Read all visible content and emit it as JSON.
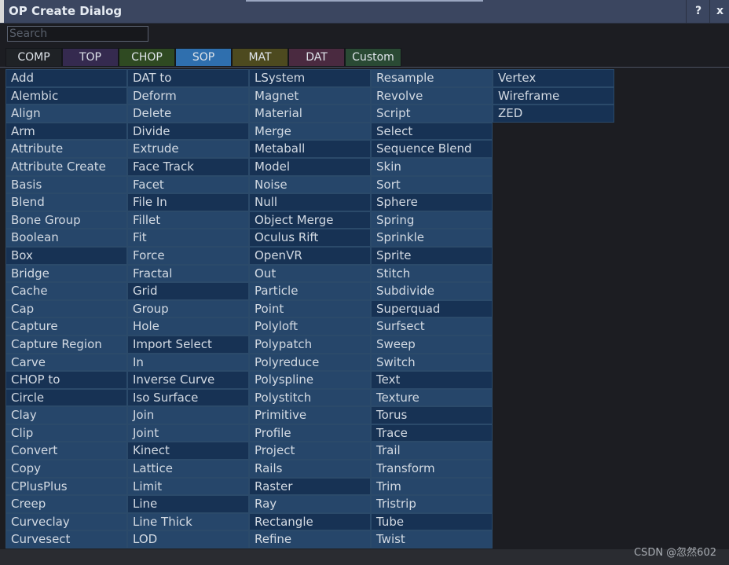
{
  "window": {
    "title": "OP Create Dialog",
    "help_label": "?",
    "close_label": "x"
  },
  "search": {
    "placeholder": "Search",
    "value": ""
  },
  "tabs": [
    {
      "label": "COMP",
      "color": "#1f2226"
    },
    {
      "label": "TOP",
      "color": "#352a4f"
    },
    {
      "label": "CHOP",
      "color": "#2f4a22"
    },
    {
      "label": "SOP",
      "color": "#2f6fae"
    },
    {
      "label": "MAT",
      "color": "#4d4a1f"
    },
    {
      "label": "DAT",
      "color": "#4a2a40"
    },
    {
      "label": "Custom",
      "color": "#2a4a34"
    }
  ],
  "active_tab": "SOP",
  "operators": [
    "Add",
    "Alembic",
    "Align",
    "Arm",
    "Attribute",
    "Attribute Create",
    "Basis",
    "Blend",
    "Bone Group",
    "Boolean",
    "Box",
    "Bridge",
    "Cache",
    "Cap",
    "Capture",
    "Capture Region",
    "Carve",
    "CHOP to",
    "Circle",
    "Clay",
    "Clip",
    "Convert",
    "Copy",
    "CPlusPlus",
    "Creep",
    "Curveclay",
    "Curvesect",
    "DAT to",
    "Deform",
    "Delete",
    "Divide",
    "Extrude",
    "Face Track",
    "Facet",
    "File In",
    "Fillet",
    "Fit",
    "Force",
    "Fractal",
    "Grid",
    "Group",
    "Hole",
    "Import Select",
    "In",
    "Inverse Curve",
    "Iso Surface",
    "Join",
    "Joint",
    "Kinect",
    "Lattice",
    "Limit",
    "Line",
    "Line Thick",
    "LOD",
    "LSystem",
    "Magnet",
    "Material",
    "Merge",
    "Metaball",
    "Model",
    "Noise",
    "Null",
    "Object Merge",
    "Oculus Rift",
    "OpenVR",
    "Out",
    "Particle",
    "Point",
    "Polyloft",
    "Polypatch",
    "Polyreduce",
    "Polyspline",
    "Polystitch",
    "Primitive",
    "Profile",
    "Project",
    "Rails",
    "Raster",
    "Ray",
    "Rectangle",
    "Refine",
    "Resample",
    "Revolve",
    "Script",
    "Select",
    "Sequence Blend",
    "Skin",
    "Sort",
    "Sphere",
    "Spring",
    "Sprinkle",
    "Sprite",
    "Stitch",
    "Subdivide",
    "Superquad",
    "Surfsect",
    "Sweep",
    "Switch",
    "Text",
    "Texture",
    "Torus",
    "Trace",
    "Trail",
    "Transform",
    "Trim",
    "Tristrip",
    "Tube",
    "Twist",
    "Vertex",
    "Wireframe",
    "ZED"
  ],
  "highlighted_operators": [
    "Add",
    "Alembic",
    "Arm",
    "Box",
    "CHOP to",
    "Circle",
    "DAT to",
    "Divide",
    "Face Track",
    "File In",
    "Grid",
    "Import Select",
    "Inverse Curve",
    "Iso Surface",
    "Kinect",
    "Line",
    "LSystem",
    "Metaball",
    "Model",
    "Null",
    "Object Merge",
    "Oculus Rift",
    "OpenVR",
    "Raster",
    "Rectangle",
    "Select",
    "Sequence Blend",
    "Sphere",
    "Sprite",
    "Superquad",
    "Text",
    "Torus",
    "Trace",
    "Tube",
    "Vertex",
    "Wireframe",
    "ZED"
  ],
  "watermark": "CSDN @忽然602"
}
